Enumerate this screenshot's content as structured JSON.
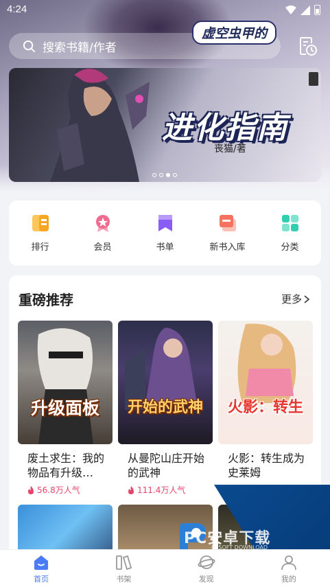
{
  "status_bar": {
    "time": "4:24"
  },
  "search": {
    "placeholder": "搜索书籍/作者"
  },
  "banner": {
    "subtitle": "虚空虫甲的",
    "title": "进化指南",
    "author": "丧猫/著"
  },
  "categories": [
    {
      "label": "排行",
      "icon": "ranking-icon",
      "color": "#f6a623"
    },
    {
      "label": "会员",
      "icon": "member-badge-icon",
      "color": "#f06b8f"
    },
    {
      "label": "书单",
      "icon": "booklist-icon",
      "color": "#8a5cf6"
    },
    {
      "label": "新书入库",
      "icon": "new-books-icon",
      "color": "#f5735e"
    },
    {
      "label": "分类",
      "icon": "category-grid-icon",
      "color": "#2fcfb0"
    }
  ],
  "recommend": {
    "title": "重磅推荐",
    "more_label": "更多",
    "books": [
      {
        "name": "废土求生：我的物品有升级…",
        "popularity": "56.8万人气",
        "cover_title": "升级面板"
      },
      {
        "name": "从曼陀山庄开始的武神",
        "popularity": "111.4万人气",
        "cover_title": "开始的武神"
      },
      {
        "name": "火影：转生成为史莱姆",
        "popularity": "",
        "cover_title": "火影：转生"
      }
    ]
  },
  "bottom_nav": [
    {
      "label": "首页",
      "icon": "home-icon",
      "active": true
    },
    {
      "label": "书架",
      "icon": "bookshelf-icon",
      "active": false
    },
    {
      "label": "发现",
      "icon": "discover-icon",
      "active": false
    },
    {
      "label": "我的",
      "icon": "profile-icon",
      "active": false
    }
  ],
  "watermark": {
    "text": "PC安卓下载",
    "sub": "PCSOFT DOWNLOAD"
  },
  "colors": {
    "accent": "#4a7cf7",
    "popularity": "#e8436b"
  }
}
